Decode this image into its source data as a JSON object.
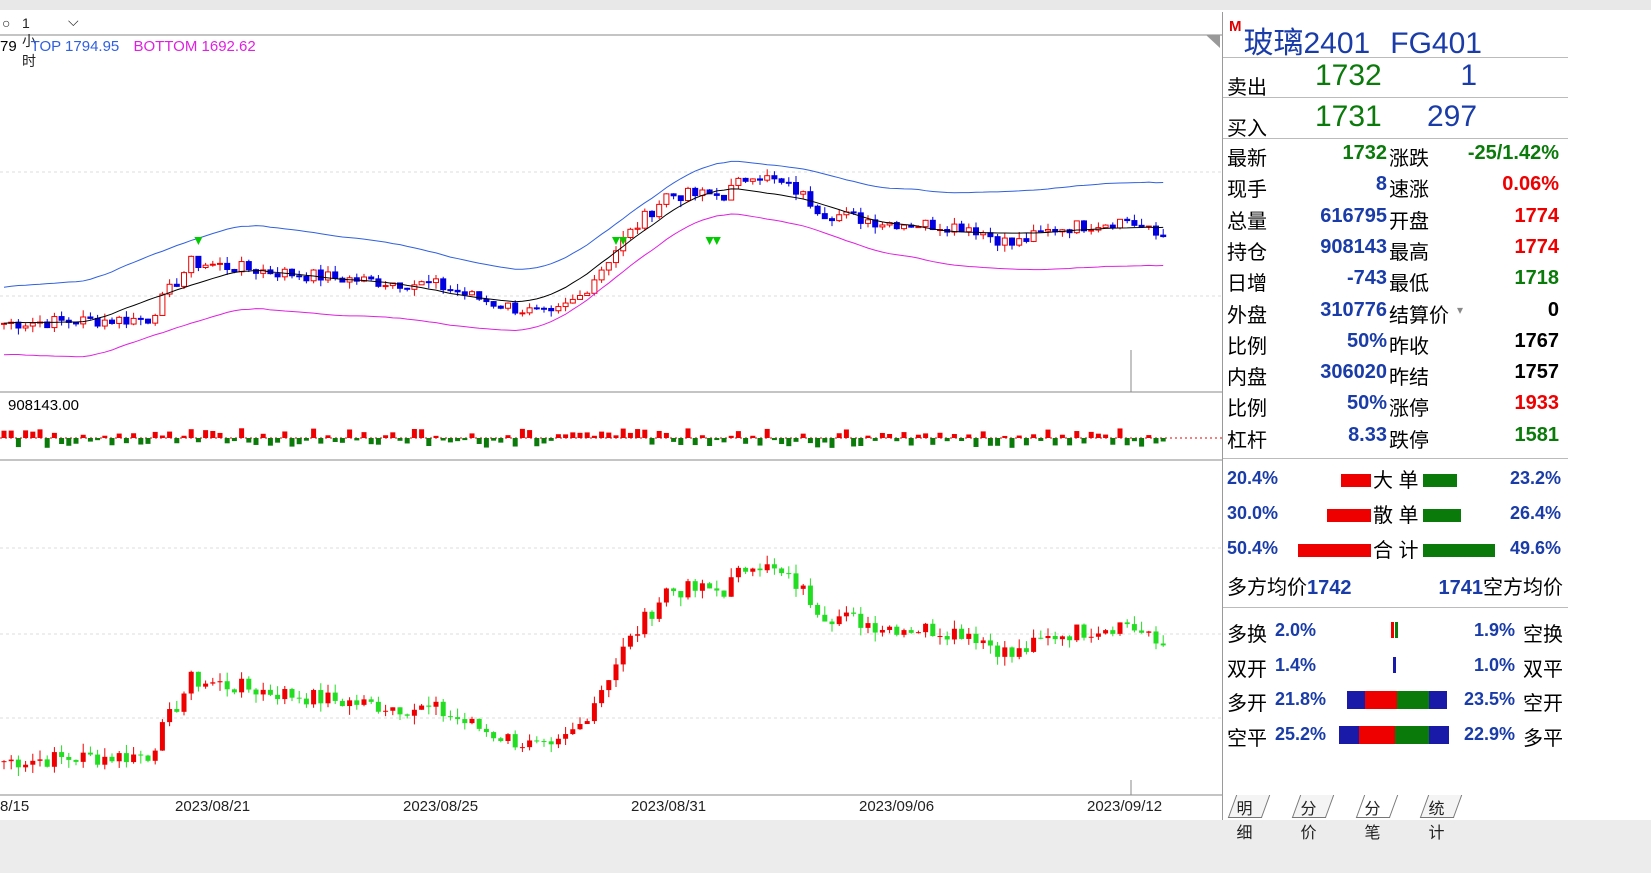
{
  "period_selector": {
    "dot": "○",
    "label": "1小时",
    "chevron": "chevron-down-icon"
  },
  "legend": {
    "mid_value": "79",
    "top": "TOP 1794.95",
    "bottom": "BOTTOM 1692.62"
  },
  "volume_label": "908143.00",
  "x_axis_labels": [
    "8/15",
    "2023/08/21",
    "2023/08/25",
    "2023/08/31",
    "2023/09/06",
    "2023/09/12"
  ],
  "colors": {
    "up": "#ee0000",
    "down_main": "#0000e0",
    "down_lower": "#22dd22",
    "top_band": "#3060e0",
    "bottom_band": "#e020e0",
    "mid_band": "#000000"
  },
  "panel": {
    "title_flag": "M",
    "name": "玻璃2401",
    "code": "FG401",
    "sell": {
      "label": "卖出",
      "price": "1732",
      "qty": "1"
    },
    "buy": {
      "label": "买入",
      "price": "1731",
      "qty": "297"
    },
    "quotes": [
      {
        "l1": "最新",
        "v1": "1732",
        "c1": "#0a7a0a",
        "l2": "涨跌",
        "v2": "-25/1.42%",
        "c2": "#0a7a0a"
      },
      {
        "l1": "现手",
        "v1": "8",
        "c1": "#1a3ca8",
        "l2": "速涨",
        "v2": "0.06%",
        "c2": "#ee0000"
      },
      {
        "l1": "总量",
        "v1": "616795",
        "c1": "#1a3ca8",
        "l2": "开盘",
        "v2": "1774",
        "c2": "#ee0000"
      },
      {
        "l1": "持仓",
        "v1": "908143",
        "c1": "#1a3ca8",
        "l2": "最高",
        "v2": "1774",
        "c2": "#ee0000"
      },
      {
        "l1": "日增",
        "v1": "-743",
        "c1": "#1a3ca8",
        "l2": "最低",
        "v2": "1718",
        "c2": "#0a7a0a"
      },
      {
        "l1": "外盘",
        "v1": "310776",
        "c1": "#1a3ca8",
        "l2": "结算价",
        "v2": "0",
        "c2": "#000000"
      },
      {
        "l1": "比例",
        "v1": "50%",
        "c1": "#1a3ca8",
        "l2": "昨收",
        "v2": "1767",
        "c2": "#000000"
      },
      {
        "l1": "内盘",
        "v1": "306020",
        "c1": "#1a3ca8",
        "l2": "昨结",
        "v2": "1757",
        "c2": "#000000"
      },
      {
        "l1": "比例",
        "v1": "50%",
        "c1": "#1a3ca8",
        "l2": "涨停",
        "v2": "1933",
        "c2": "#ee0000"
      },
      {
        "l1": "杠杆",
        "v1": "8.33",
        "c1": "#1a3ca8",
        "l2": "跌停",
        "v2": "1581",
        "c2": "#0a7a0a"
      }
    ],
    "flows": [
      {
        "left": "20.4%",
        "name": "大 单",
        "right": "23.2%",
        "buy": 0.204,
        "sell": 0.232
      },
      {
        "left": "30.0%",
        "name": "散 单",
        "right": "26.4%",
        "buy": 0.3,
        "sell": 0.264
      },
      {
        "left": "50.4%",
        "name": "合 计",
        "right": "49.6%",
        "buy": 0.504,
        "sell": 0.496
      }
    ],
    "avg": {
      "long_label": "多方均价",
      "long_value": "1742",
      "short_value": "1741",
      "short_label": "空方均价"
    },
    "changes": [
      {
        "n1": "多换",
        "p1": "2.0%",
        "p2": "1.9%",
        "n2": "空换"
      },
      {
        "n1": "双开",
        "p1": "1.4%",
        "p2": "1.0%",
        "n2": "双平"
      },
      {
        "n1": "多开",
        "p1": "21.8%",
        "p2": "23.5%",
        "n2": "空开"
      },
      {
        "n1": "空平",
        "p1": "25.2%",
        "p2": "22.9%",
        "n2": "多平"
      }
    ],
    "tabs": [
      "明细",
      "分价",
      "分笔",
      "统计"
    ]
  }
}
